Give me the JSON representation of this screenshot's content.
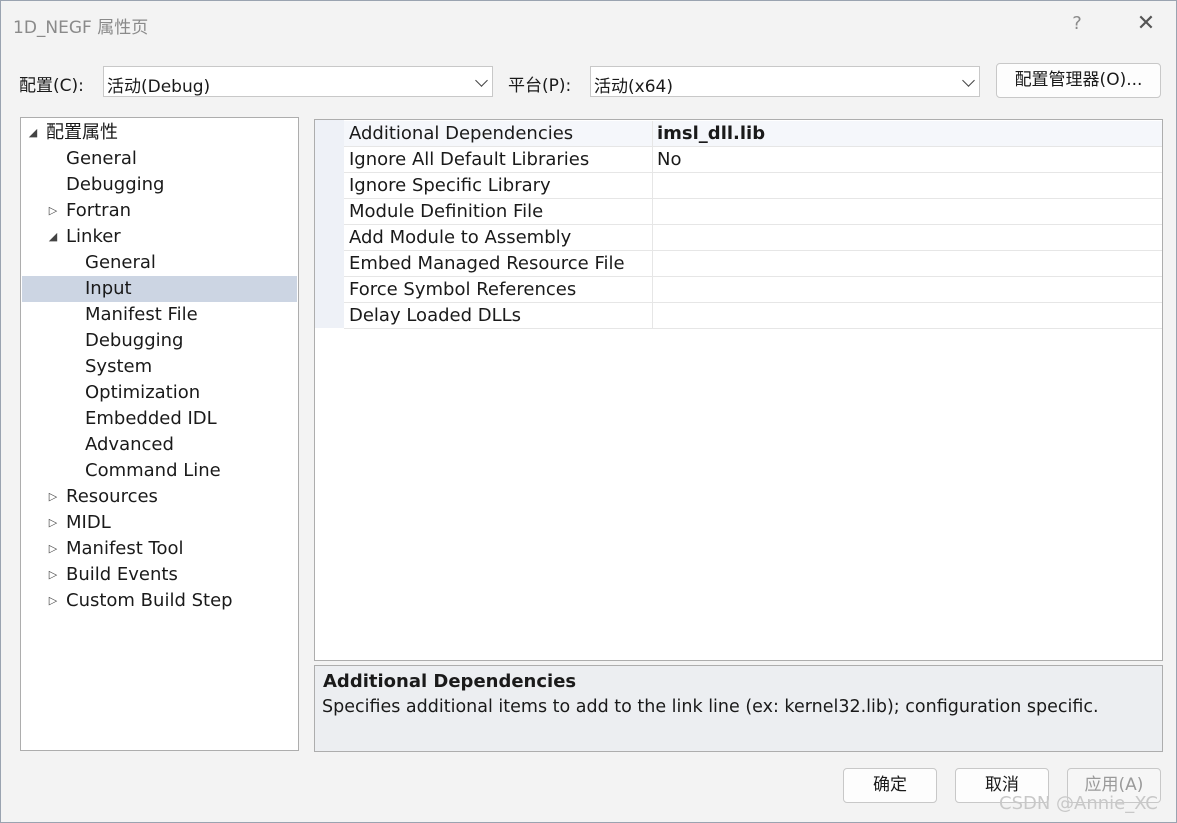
{
  "window": {
    "title": "1D_NEGF 属性页",
    "help_label": "?",
    "close_label": "✕"
  },
  "config_bar": {
    "config_label": "配置(C):",
    "config_value": "活动(Debug)",
    "platform_label": "平台(P):",
    "platform_value": "活动(x64)",
    "manager_button": "配置管理器(O)..."
  },
  "tree": {
    "items": [
      {
        "label": "配置属性",
        "expander": "expanded",
        "level": 0
      },
      {
        "label": "General",
        "expander": "none",
        "level": 1
      },
      {
        "label": "Debugging",
        "expander": "none",
        "level": 1
      },
      {
        "label": "Fortran",
        "expander": "collapsed",
        "level": 1
      },
      {
        "label": "Linker",
        "expander": "expanded",
        "level": 1
      },
      {
        "label": "General",
        "expander": "none",
        "level": 2
      },
      {
        "label": "Input",
        "expander": "none",
        "level": 2,
        "selected": true
      },
      {
        "label": "Manifest File",
        "expander": "none",
        "level": 2
      },
      {
        "label": "Debugging",
        "expander": "none",
        "level": 2
      },
      {
        "label": "System",
        "expander": "none",
        "level": 2
      },
      {
        "label": "Optimization",
        "expander": "none",
        "level": 2
      },
      {
        "label": "Embedded IDL",
        "expander": "none",
        "level": 2
      },
      {
        "label": "Advanced",
        "expander": "none",
        "level": 2
      },
      {
        "label": "Command Line",
        "expander": "none",
        "level": 2
      },
      {
        "label": "Resources",
        "expander": "collapsed",
        "level": 1
      },
      {
        "label": "MIDL",
        "expander": "collapsed",
        "level": 1
      },
      {
        "label": "Manifest Tool",
        "expander": "collapsed",
        "level": 1
      },
      {
        "label": "Build Events",
        "expander": "collapsed",
        "level": 1
      },
      {
        "label": "Custom Build Step",
        "expander": "collapsed",
        "level": 1
      }
    ]
  },
  "properties": {
    "rows": [
      {
        "name": "Additional Dependencies",
        "value": "imsl_dll.lib",
        "bold": true
      },
      {
        "name": "Ignore All Default Libraries",
        "value": "No",
        "bold": false
      },
      {
        "name": "Ignore Specific Library",
        "value": "",
        "bold": false
      },
      {
        "name": "Module Definition File",
        "value": "",
        "bold": false
      },
      {
        "name": "Add Module to Assembly",
        "value": "",
        "bold": false
      },
      {
        "name": "Embed Managed Resource File",
        "value": "",
        "bold": false
      },
      {
        "name": "Force Symbol References",
        "value": "",
        "bold": false
      },
      {
        "name": "Delay Loaded DLLs",
        "value": "",
        "bold": false
      }
    ]
  },
  "description": {
    "title": "Additional Dependencies",
    "text": "Specifies additional items to add to the link line (ex: kernel32.lib); configuration specific."
  },
  "buttons": {
    "ok": "确定",
    "cancel": "取消",
    "apply": "应用(A)"
  },
  "watermark": "CSDN @Annie_XC"
}
